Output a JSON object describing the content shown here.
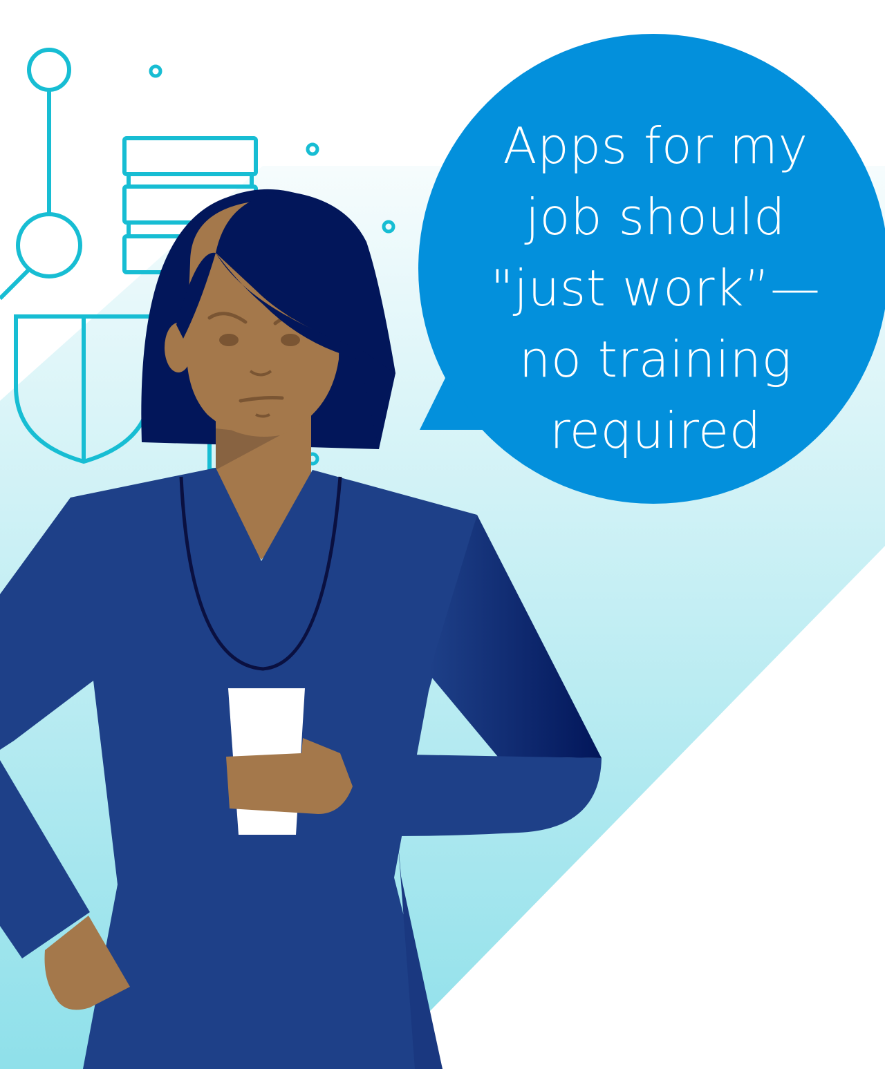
{
  "speech_bubble": {
    "lines": [
      "Apps for my",
      "job should",
      "\"just work”—",
      "no training",
      "required"
    ]
  },
  "colors": {
    "bubble": "#0390dc",
    "shirt": "#1e4088",
    "hair": "#02165a",
    "skin": "#a4784b",
    "icon_outline": "#17bdd3",
    "background_gradient_top": "#f6fcfd",
    "background_gradient_bottom": "#8fe0ea"
  },
  "icons": [
    "network-node-icon",
    "database-stack-icon",
    "shield-icon"
  ]
}
